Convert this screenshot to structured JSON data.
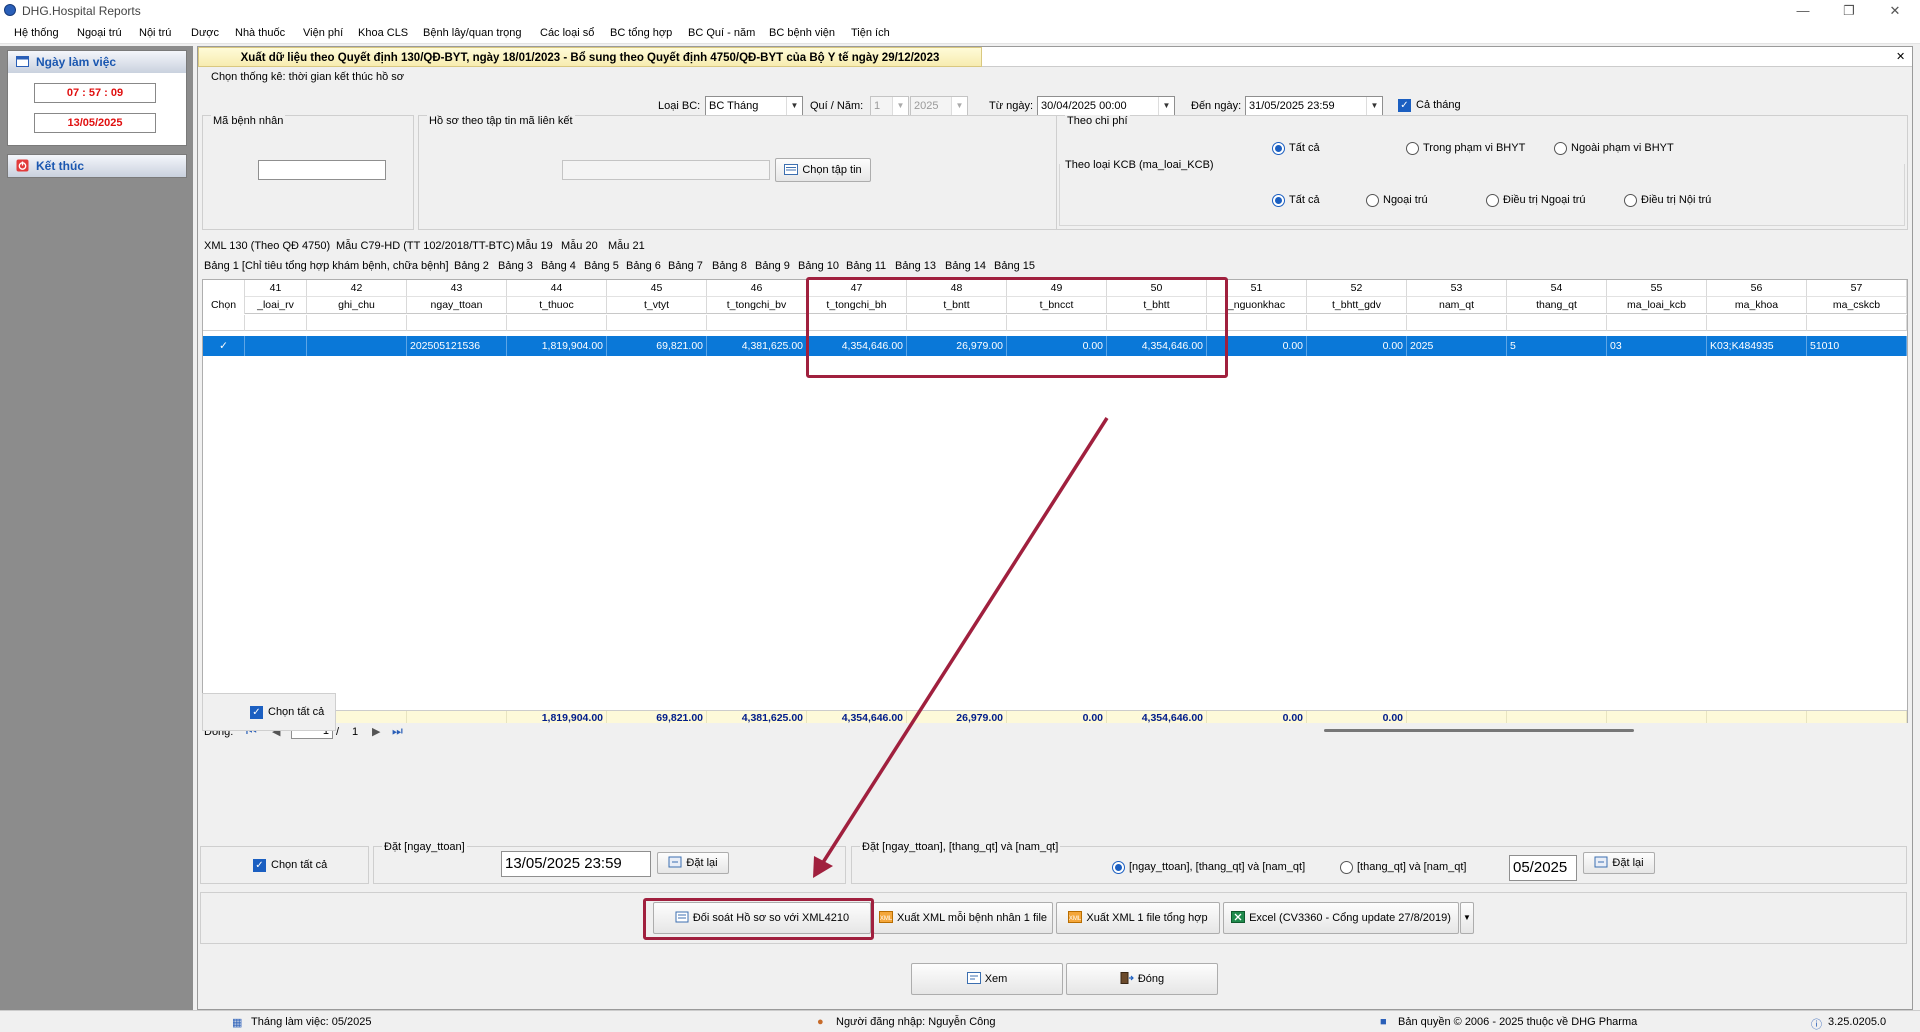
{
  "app": {
    "title": "DHG.Hospital Reports"
  },
  "menu": [
    "Hệ thống",
    "Ngoại trú",
    "Nội trú",
    "Dược",
    "Nhà thuốc",
    "Viện phí",
    "Khoa CLS",
    "Bệnh lây/quan trọng",
    "Các loại sổ",
    "BC tổng hợp",
    "BC Quí - năm",
    "BC bệnh viện",
    "Tiện ích"
  ],
  "left": {
    "workday_label": "Ngày làm việc",
    "time": "07 : 57 : 09",
    "date": "13/05/2025",
    "exit_label": "Kết thúc"
  },
  "main": {
    "header": "Xuất dữ liệu theo Quyết định 130/QĐ-BYT, ngày 18/01/2023 - Bổ sung theo Quyết định 4750/QĐ-BYT của Bộ Y tế ngày 29/12/2023",
    "close": "✕"
  },
  "filters": {
    "stat_mode": "Chọn thống kê: thời gian kết thúc hồ sơ",
    "loai_bc_label": "Loại BC:",
    "loai_bc": "BC Tháng",
    "quy_nam_label": "Quí / Năm:",
    "quy": "1",
    "nam": "2025",
    "tu_ngay_label": "Từ ngày:",
    "tu_ngay": "30/04/2025 00:00",
    "den_ngay_label": "Đến ngày:",
    "den_ngay": "31/05/2025 23:59",
    "ca_thang": "Cả tháng",
    "ma_benh_nhan": "Mã bệnh nhân",
    "ho_so_label": "Hồ sơ theo tập tin mã liên kết",
    "chon_tap_tin": "Chọn tập tin",
    "theo_chi_phi": "Theo chi phí",
    "chi_phi_options": [
      "Tất cả",
      "Trong phạm vi BHYT",
      "Ngoài phạm vi BHYT"
    ],
    "theo_loai_kcb": "Theo loại KCB (ma_loai_KCB)",
    "kcb_options": [
      "Tất cả",
      "Ngoại trú",
      "Điều trị Ngoại trú",
      "Điều trị Nội trú"
    ]
  },
  "tabs1": [
    "XML 130 (Theo QĐ 4750)",
    "Mẫu C79-HD (TT 102/2018/TT-BTC)",
    "Mẫu 19",
    "Mẫu 20",
    "Mẫu 21"
  ],
  "tabs2": [
    "Bảng 1 [Chỉ tiêu tổng hợp khám bệnh, chữa bệnh]",
    "Bảng 2",
    "Bảng 3",
    "Bảng 4",
    "Bảng 5",
    "Bảng 6",
    "Bảng 7",
    "Bảng 8",
    "Bảng 9",
    "Bảng 10",
    "Bảng 11",
    "Bảng 13",
    "Bảng 14",
    "Bảng 15"
  ],
  "grid": {
    "chon": "Chọn",
    "nums": [
      "41",
      "42",
      "43",
      "44",
      "45",
      "46",
      "47",
      "48",
      "49",
      "50",
      "51",
      "52",
      "53",
      "54",
      "55",
      "56",
      "57"
    ],
    "cols": [
      "_loai_rv",
      "ghi_chu",
      "ngay_ttoan",
      "t_thuoc",
      "t_vtyt",
      "t_tongchi_bv",
      "t_tongchi_bh",
      "t_bntt",
      "t_bncct",
      "t_bhtt",
      "_nguonkhac",
      "t_bhtt_gdv",
      "nam_qt",
      "thang_qt",
      "ma_loai_kcb",
      "ma_khoa",
      "ma_cskcb"
    ],
    "row": [
      "",
      "",
      "202505121536",
      "1,819,904.00",
      "69,821.00",
      "4,381,625.00",
      "4,354,646.00",
      "26,979.00",
      "0.00",
      "4,354,646.00",
      "0.00",
      "0.00",
      "2025",
      "5",
      "03",
      "K03;K484935",
      "51010"
    ],
    "totals": [
      "",
      "",
      "",
      "1,819,904.00",
      "69,821.00",
      "4,381,625.00",
      "4,354,646.00",
      "26,979.00",
      "0.00",
      "4,354,646.00",
      "0.00",
      "0.00",
      "",
      "",
      "",
      "",
      ""
    ],
    "nav_label": "Dòng:",
    "page": "1",
    "of": "/",
    "pages": "1"
  },
  "bottom": {
    "chon_tat_ca": "Chọn tất cả",
    "dat_ngay_ttoan": "Đặt [ngay_ttoan]",
    "ngay_ttoan_value": "13/05/2025 23:59",
    "dat_lai": "Đặt lại",
    "dat_group": "Đặt  [ngay_ttoan], [thang_qt] và [nam_qt]",
    "opt1": "[ngay_ttoan], [thang_qt] và [nam_qt]",
    "opt2": "[thang_qt] và [nam_qt]",
    "thang_value": "05/2025",
    "doi_soat": "Đối soát Hồ sơ so với XML4210",
    "xuat_moi": "Xuất XML mỗi bệnh nhân 1 file",
    "xuat_tong": "Xuất XML 1 file tổng hợp",
    "excel": "Excel (CV3360 - Cổng update 27/8/2019)",
    "xem": "Xem",
    "dong": "Đóng"
  },
  "status": {
    "thang": "Tháng làm việc: 05/2025",
    "user": "Người đăng nhập: Nguyễn Công",
    "copyright": "Bản quyền © 2006 - 2025 thuộc về DHG Pharma",
    "version": "3.25.0205.0"
  },
  "colors": {
    "accent": "#0a78d8",
    "highlight": "#a0203e",
    "header_red": "#e01010"
  }
}
